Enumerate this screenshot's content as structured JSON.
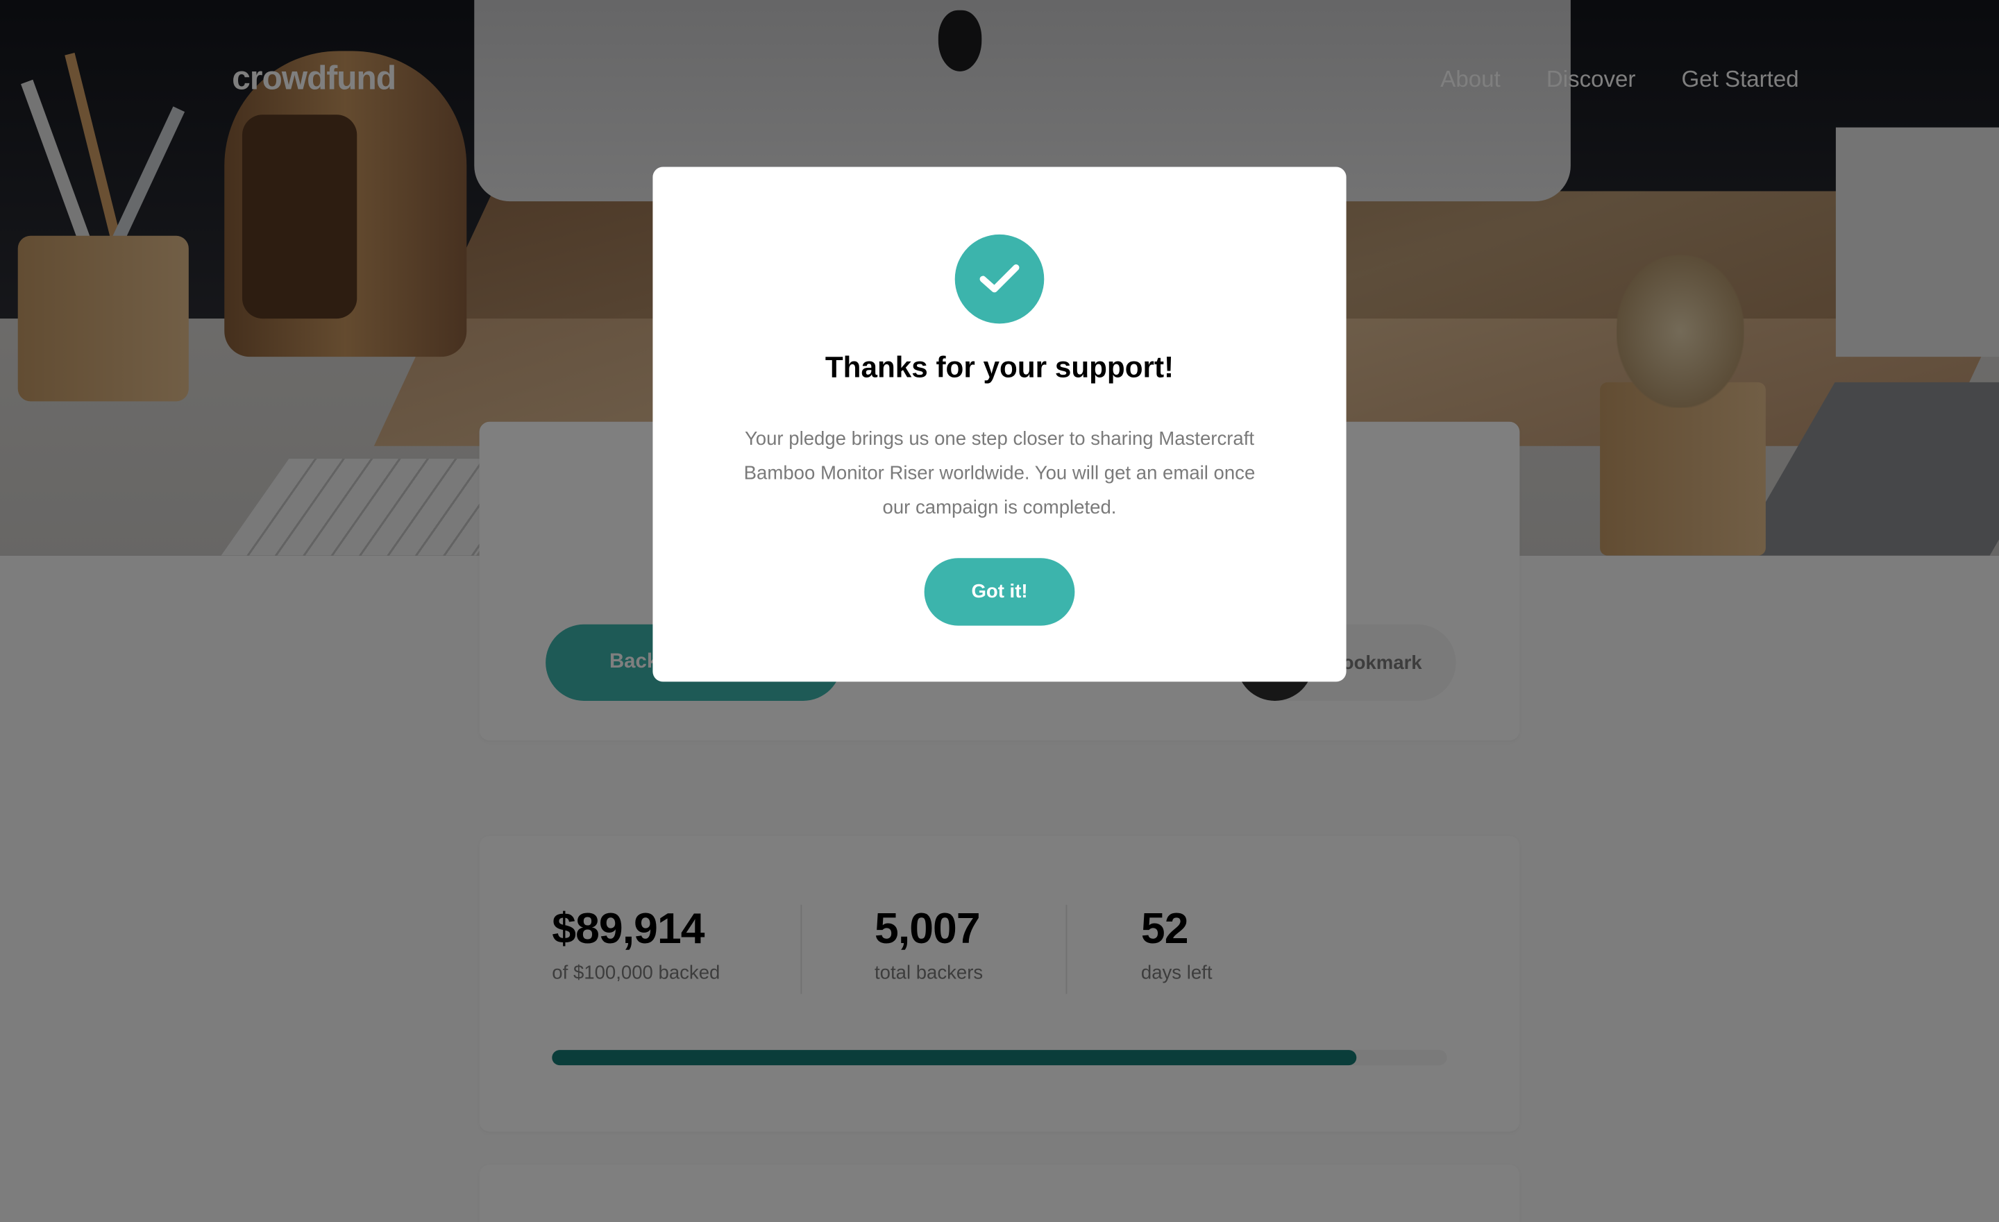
{
  "header": {
    "logo": "crowdfund",
    "nav": [
      "About",
      "Discover",
      "Get Started"
    ]
  },
  "project": {
    "back_label": "Back this project",
    "bookmark_label": "Bookmark"
  },
  "stats": {
    "backed_value": "$89,914",
    "backed_label": "of $100,000 backed",
    "backers_value": "5,007",
    "backers_label": "total backers",
    "days_value": "52",
    "days_label": "days left",
    "progress_fraction": 0.899
  },
  "modal": {
    "title": "Thanks for your support!",
    "body": "Your pledge brings us one step closer to sharing Mastercraft Bamboo Monitor Riser worldwide. You will get an email once our campaign is completed.",
    "button_label": "Got it!",
    "icon": "check-icon"
  },
  "colors": {
    "accent": "#3cb4ac",
    "accent_dark": "#147b74"
  }
}
